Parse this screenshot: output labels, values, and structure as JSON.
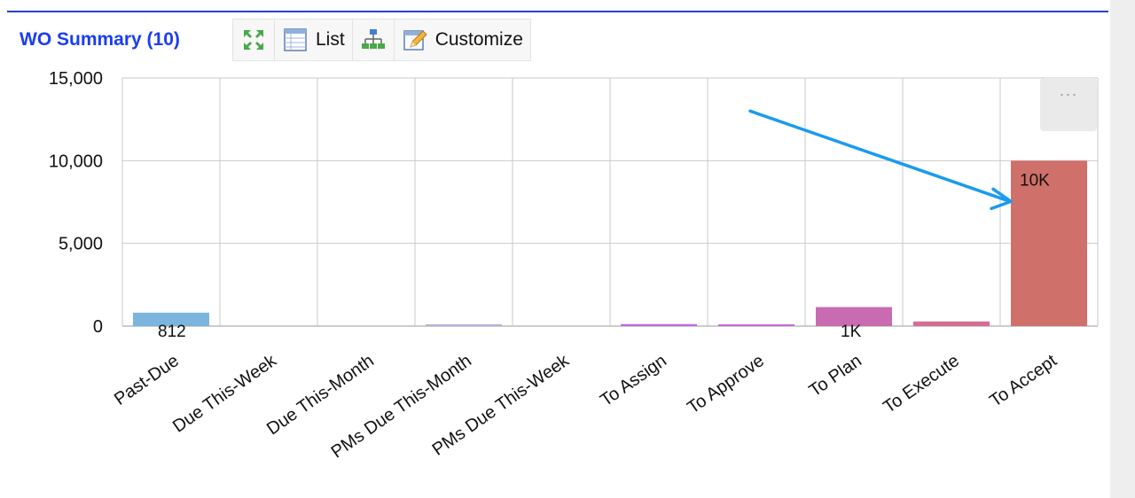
{
  "header": {
    "title": "WO Summary (10)",
    "list_label": "List",
    "customize_label": "Customize",
    "icons": {
      "expand": "expand-arrows-icon",
      "list": "list-table-icon",
      "hierarchy": "hierarchy-icon",
      "customize": "customize-pencil-icon"
    }
  },
  "more_button": {
    "label": "···"
  },
  "colors": {
    "accent": "#1b3df0",
    "annotation_arrow": "#1a9bef"
  },
  "chart_data": {
    "type": "bar",
    "categories": [
      "Past-Due",
      "Due This-Week",
      "Due This-Month",
      "PMs Due This-Month",
      "PMs Due This-Week",
      "To Assign",
      "To Approve",
      "To Plan",
      "To Execute",
      "To Accept"
    ],
    "values": [
      812,
      0,
      0,
      40,
      0,
      120,
      100,
      1150,
      280,
      10000
    ],
    "data_labels": [
      "812",
      "",
      "",
      "",
      "",
      "",
      "",
      "1K",
      "",
      "10K"
    ],
    "colors": [
      "#7bb4dc",
      "#cccccc",
      "#cccccc",
      "#b8b0dd",
      "#cccccc",
      "#b86ee0",
      "#c86ad8",
      "#c86bb0",
      "#d46e8e",
      "#d0706a"
    ],
    "yticks": [
      0,
      5000,
      10000,
      15000
    ],
    "ytick_labels": [
      "0",
      "5,000",
      "10,000",
      "15,000"
    ],
    "ylim": [
      0,
      15000
    ],
    "grid": true,
    "annotation": {
      "type": "arrow",
      "points_to": "To Accept"
    }
  }
}
